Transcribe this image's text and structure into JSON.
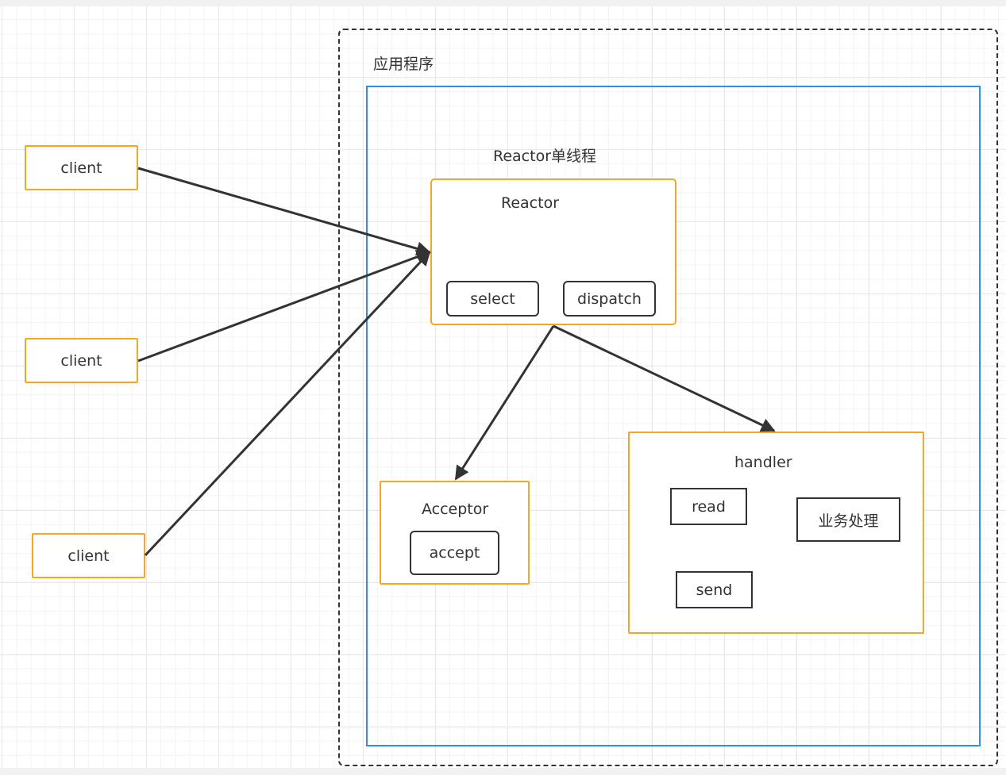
{
  "diagram": {
    "app_label": "应用程序",
    "reactor_thread_label": "Reactor单线程",
    "clients": [
      "client",
      "client",
      "client"
    ],
    "reactor": {
      "title": "Reactor",
      "select": "select",
      "dispatch": "dispatch"
    },
    "acceptor": {
      "title": "Acceptor",
      "accept": "accept"
    },
    "handler": {
      "title": "handler",
      "read": "read",
      "business": "业务处理",
      "send": "send"
    },
    "colors": {
      "orange": "#f5a623",
      "blue": "#2f8fe3",
      "dark": "#333333"
    }
  }
}
